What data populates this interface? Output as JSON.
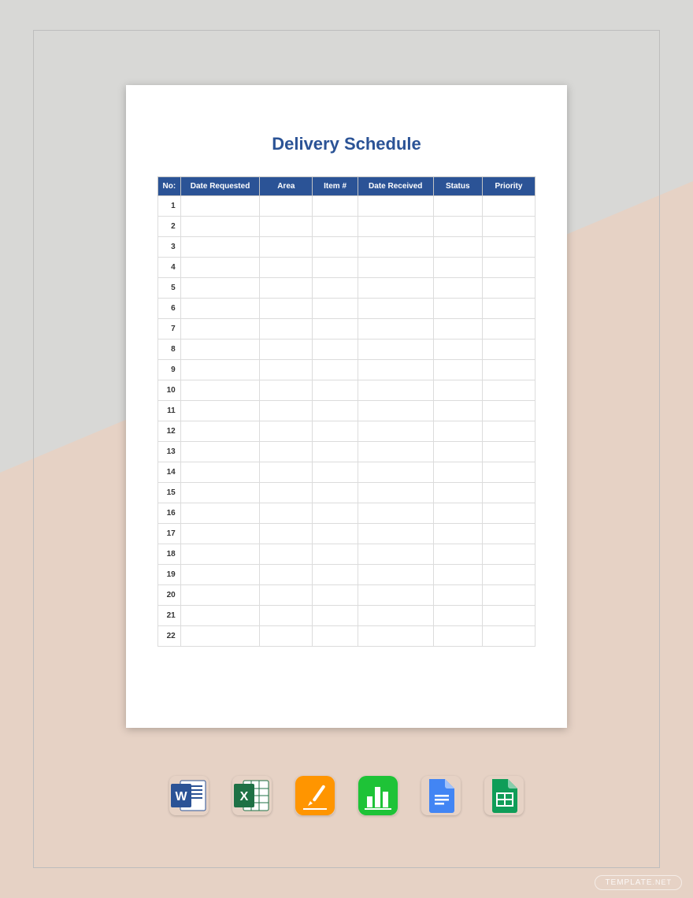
{
  "document": {
    "title": "Delivery Schedule",
    "columns": [
      "No:",
      "Date Requested",
      "Area",
      "Item #",
      "Date Received",
      "Status",
      "Priority"
    ],
    "rows": [
      {
        "no": "1",
        "date_requested": "",
        "area": "",
        "item": "",
        "date_received": "",
        "status": "",
        "priority": ""
      },
      {
        "no": "2",
        "date_requested": "",
        "area": "",
        "item": "",
        "date_received": "",
        "status": "",
        "priority": ""
      },
      {
        "no": "3",
        "date_requested": "",
        "area": "",
        "item": "",
        "date_received": "",
        "status": "",
        "priority": ""
      },
      {
        "no": "4",
        "date_requested": "",
        "area": "",
        "item": "",
        "date_received": "",
        "status": "",
        "priority": ""
      },
      {
        "no": "5",
        "date_requested": "",
        "area": "",
        "item": "",
        "date_received": "",
        "status": "",
        "priority": ""
      },
      {
        "no": "6",
        "date_requested": "",
        "area": "",
        "item": "",
        "date_received": "",
        "status": "",
        "priority": ""
      },
      {
        "no": "7",
        "date_requested": "",
        "area": "",
        "item": "",
        "date_received": "",
        "status": "",
        "priority": ""
      },
      {
        "no": "8",
        "date_requested": "",
        "area": "",
        "item": "",
        "date_received": "",
        "status": "",
        "priority": ""
      },
      {
        "no": "9",
        "date_requested": "",
        "area": "",
        "item": "",
        "date_received": "",
        "status": "",
        "priority": ""
      },
      {
        "no": "10",
        "date_requested": "",
        "area": "",
        "item": "",
        "date_received": "",
        "status": "",
        "priority": ""
      },
      {
        "no": "11",
        "date_requested": "",
        "area": "",
        "item": "",
        "date_received": "",
        "status": "",
        "priority": ""
      },
      {
        "no": "12",
        "date_requested": "",
        "area": "",
        "item": "",
        "date_received": "",
        "status": "",
        "priority": ""
      },
      {
        "no": "13",
        "date_requested": "",
        "area": "",
        "item": "",
        "date_received": "",
        "status": "",
        "priority": ""
      },
      {
        "no": "14",
        "date_requested": "",
        "area": "",
        "item": "",
        "date_received": "",
        "status": "",
        "priority": ""
      },
      {
        "no": "15",
        "date_requested": "",
        "area": "",
        "item": "",
        "date_received": "",
        "status": "",
        "priority": ""
      },
      {
        "no": "16",
        "date_requested": "",
        "area": "",
        "item": "",
        "date_received": "",
        "status": "",
        "priority": ""
      },
      {
        "no": "17",
        "date_requested": "",
        "area": "",
        "item": "",
        "date_received": "",
        "status": "",
        "priority": ""
      },
      {
        "no": "18",
        "date_requested": "",
        "area": "",
        "item": "",
        "date_received": "",
        "status": "",
        "priority": ""
      },
      {
        "no": "19",
        "date_requested": "",
        "area": "",
        "item": "",
        "date_received": "",
        "status": "",
        "priority": ""
      },
      {
        "no": "20",
        "date_requested": "",
        "area": "",
        "item": "",
        "date_received": "",
        "status": "",
        "priority": ""
      },
      {
        "no": "21",
        "date_requested": "",
        "area": "",
        "item": "",
        "date_received": "",
        "status": "",
        "priority": ""
      },
      {
        "no": "22",
        "date_requested": "",
        "area": "",
        "item": "",
        "date_received": "",
        "status": "",
        "priority": ""
      }
    ]
  },
  "apps": [
    {
      "name": "word-icon"
    },
    {
      "name": "excel-icon"
    },
    {
      "name": "pages-icon"
    },
    {
      "name": "numbers-icon"
    },
    {
      "name": "google-docs-icon"
    },
    {
      "name": "google-sheets-icon"
    }
  ],
  "watermark": {
    "brand": "TEMPLATE",
    "tld": ".NET"
  }
}
